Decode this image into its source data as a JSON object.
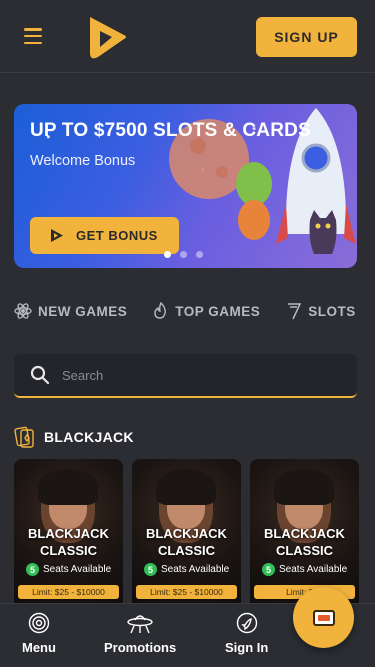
{
  "header": {
    "signup_label": "SIGN UP",
    "brand_color": "#f2b33d"
  },
  "banner": {
    "title": "UP TO $7500 SLOTS & CARDS",
    "subtitle": "Welcome Bonus",
    "cta_label": "GET BONUS",
    "slide_count": 3,
    "active_slide": 1
  },
  "categories": [
    {
      "label": "NEW GAMES",
      "icon": "atom-icon"
    },
    {
      "label": "TOP GAMES",
      "icon": "flame-icon"
    },
    {
      "label": "SLOTS",
      "icon": "seven-icon"
    }
  ],
  "search": {
    "placeholder": "Search"
  },
  "section": {
    "title": "BLACKJACK",
    "icon": "cards-icon"
  },
  "games": [
    {
      "title_line1": "BLACKJACK",
      "title_line2": "CLASSIC",
      "seats_count": "5",
      "seats_text": "Seats Available",
      "limit": "Limit: $25 - $10000"
    },
    {
      "title_line1": "BLACKJACK",
      "title_line2": "CLASSIC",
      "seats_count": "5",
      "seats_text": "Seats Available",
      "limit": "Limit: $25 - $10000"
    },
    {
      "title_line1": "BLACKJACK",
      "title_line2": "CLASSIC",
      "seats_count": "5",
      "seats_text": "Seats Available",
      "limit": "Limit: $50"
    }
  ],
  "bottom_nav": [
    {
      "label": "Menu",
      "icon": "target-icon"
    },
    {
      "label": "Promotions",
      "icon": "ufo-icon"
    },
    {
      "label": "Sign In",
      "icon": "rocket-icon"
    }
  ]
}
